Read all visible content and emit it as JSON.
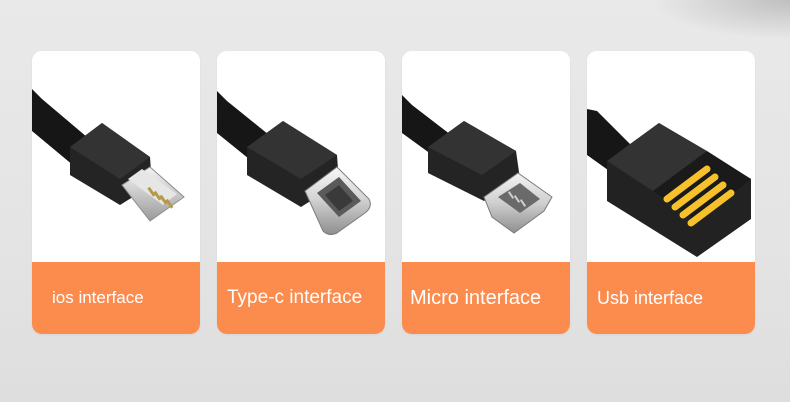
{
  "cards": [
    {
      "label": "ios  interface",
      "connector": "lightning-connector"
    },
    {
      "label": "Type-c interface",
      "connector": "usb-c-connector"
    },
    {
      "label": "Micro interface",
      "connector": "micro-usb-connector"
    },
    {
      "label": "Usb interface",
      "connector": "usb-a-connector"
    }
  ],
  "colors": {
    "label_bar": "#fb8c4e",
    "label_text": "#ffffff",
    "cable": "#1c1c1c",
    "card": "#ffffff",
    "usb_contacts": "#f6c12a"
  }
}
